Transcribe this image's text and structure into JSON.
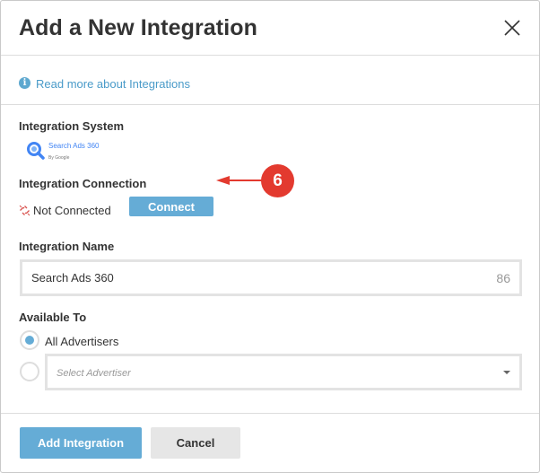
{
  "dialog": {
    "title": "Add a New Integration"
  },
  "info": {
    "icon": "info-icon",
    "link_text": "Read more about Integrations"
  },
  "integration_system": {
    "label": "Integration System",
    "logo_name": "Search Ads 360",
    "logo_sub": "By Google"
  },
  "integration_connection": {
    "label": "Integration Connection",
    "status_icon": "broken-link-icon",
    "status_text": "Not Connected",
    "connect_label": "Connect"
  },
  "callout": {
    "number": "6",
    "color": "#e33a2f"
  },
  "integration_name": {
    "label": "Integration Name",
    "value": "Search Ads 360",
    "char_count": "86"
  },
  "available_to": {
    "label": "Available To",
    "options": [
      {
        "label": "All Advertisers",
        "selected": true
      },
      {
        "label": "",
        "selected": false
      }
    ],
    "select_placeholder": "Select Advertiser"
  },
  "footer": {
    "primary_label": "Add Integration",
    "secondary_label": "Cancel"
  },
  "colors": {
    "accent": "#65acd6",
    "link": "#4a9bc9",
    "danger": "#e33a2f"
  }
}
